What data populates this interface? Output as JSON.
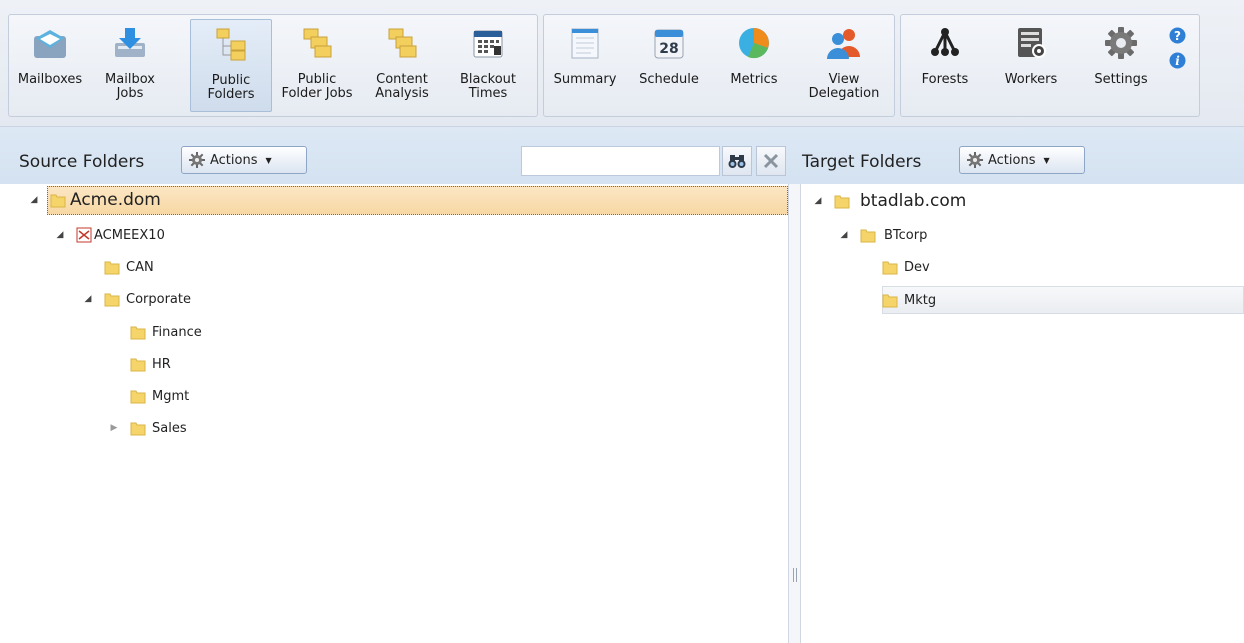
{
  "ribbon": {
    "buttons": [
      {
        "key": "mailboxes",
        "label": "Mailboxes"
      },
      {
        "key": "mailbox_jobs",
        "label": "Mailbox\nJobs"
      },
      {
        "key": "public_folders",
        "label": "Public\nFolders",
        "selected": true
      },
      {
        "key": "public_folder_jobs",
        "label": "Public\nFolder Jobs"
      },
      {
        "key": "content_analysis",
        "label": "Content\nAnalysis"
      },
      {
        "key": "blackout_times",
        "label": "Blackout\nTimes"
      },
      {
        "key": "summary",
        "label": "Summary"
      },
      {
        "key": "schedule",
        "label": "Schedule"
      },
      {
        "key": "metrics",
        "label": "Metrics"
      },
      {
        "key": "view_delegation",
        "label": "View\nDelegation"
      },
      {
        "key": "forests",
        "label": "Forests"
      },
      {
        "key": "workers",
        "label": "Workers"
      },
      {
        "key": "settings",
        "label": "Settings"
      }
    ],
    "schedule_day": "28"
  },
  "source": {
    "title": "Source Folders",
    "actions_label": "Actions",
    "search_value": "",
    "tree": {
      "root": "Acme.dom",
      "server": "ACMEEX10",
      "folders": [
        "CAN",
        "Corporate",
        "Finance",
        "HR",
        "Mgmt",
        "Sales"
      ]
    }
  },
  "target": {
    "title": "Target Folders",
    "actions_label": "Actions",
    "tree": {
      "root": "btadlab.com",
      "org": "BTcorp",
      "folders": [
        "Dev",
        "Mktg"
      ]
    }
  },
  "colors": {
    "header_bg": "#d8e5f3",
    "selection_root": "#f9dca9",
    "folder_yellow": "#f5d56a",
    "accent_blue": "#2f7fd6"
  }
}
